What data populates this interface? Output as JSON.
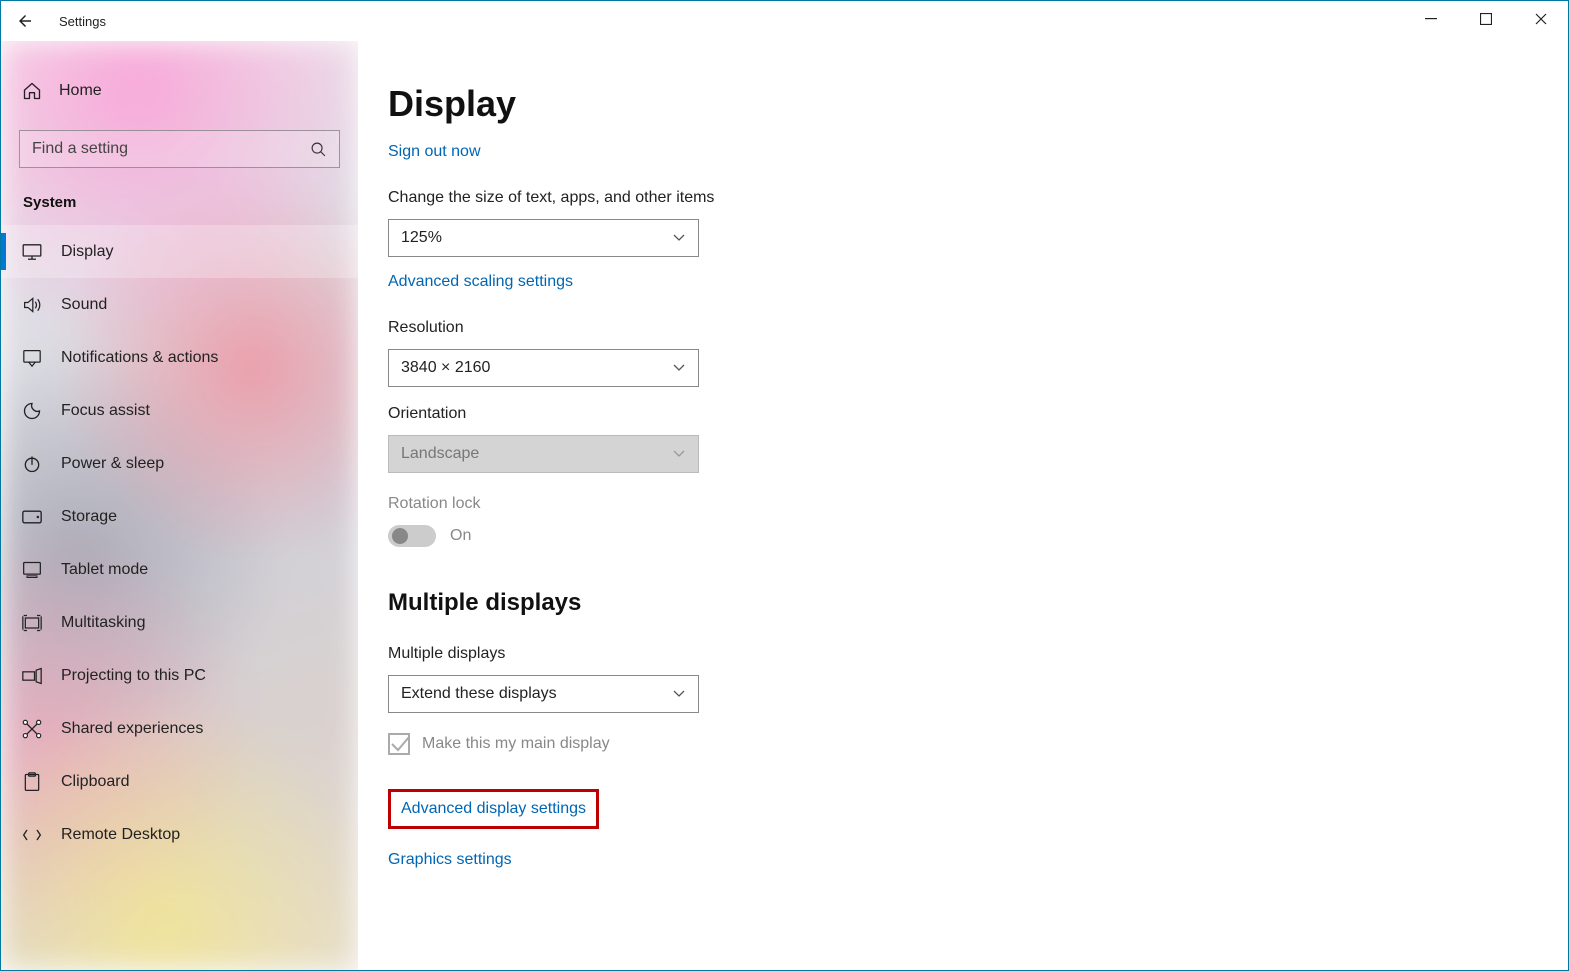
{
  "window": {
    "title": "Settings"
  },
  "sidebar": {
    "home_label": "Home",
    "search_placeholder": "Find a setting",
    "section_label": "System",
    "items": [
      {
        "label": "Display"
      },
      {
        "label": "Sound"
      },
      {
        "label": "Notifications & actions"
      },
      {
        "label": "Focus assist"
      },
      {
        "label": "Power & sleep"
      },
      {
        "label": "Storage"
      },
      {
        "label": "Tablet mode"
      },
      {
        "label": "Multitasking"
      },
      {
        "label": "Projecting to this PC"
      },
      {
        "label": "Shared experiences"
      },
      {
        "label": "Clipboard"
      },
      {
        "label": "Remote Desktop"
      }
    ]
  },
  "content": {
    "title": "Display",
    "signout_link": "Sign out now",
    "scale_label": "Change the size of text, apps, and other items",
    "scale_value": "125%",
    "adv_scaling_link": "Advanced scaling settings",
    "resolution_label": "Resolution",
    "resolution_value": "3840 × 2160",
    "orientation_label": "Orientation",
    "orientation_value": "Landscape",
    "rotation_lock_label": "Rotation lock",
    "rotation_lock_state": "On",
    "multdisp_heading": "Multiple displays",
    "multdisp_label": "Multiple displays",
    "multdisp_value": "Extend these displays",
    "main_display_checkbox": "Make this my main display",
    "adv_display_link": "Advanced display settings",
    "graphics_link": "Graphics settings"
  }
}
